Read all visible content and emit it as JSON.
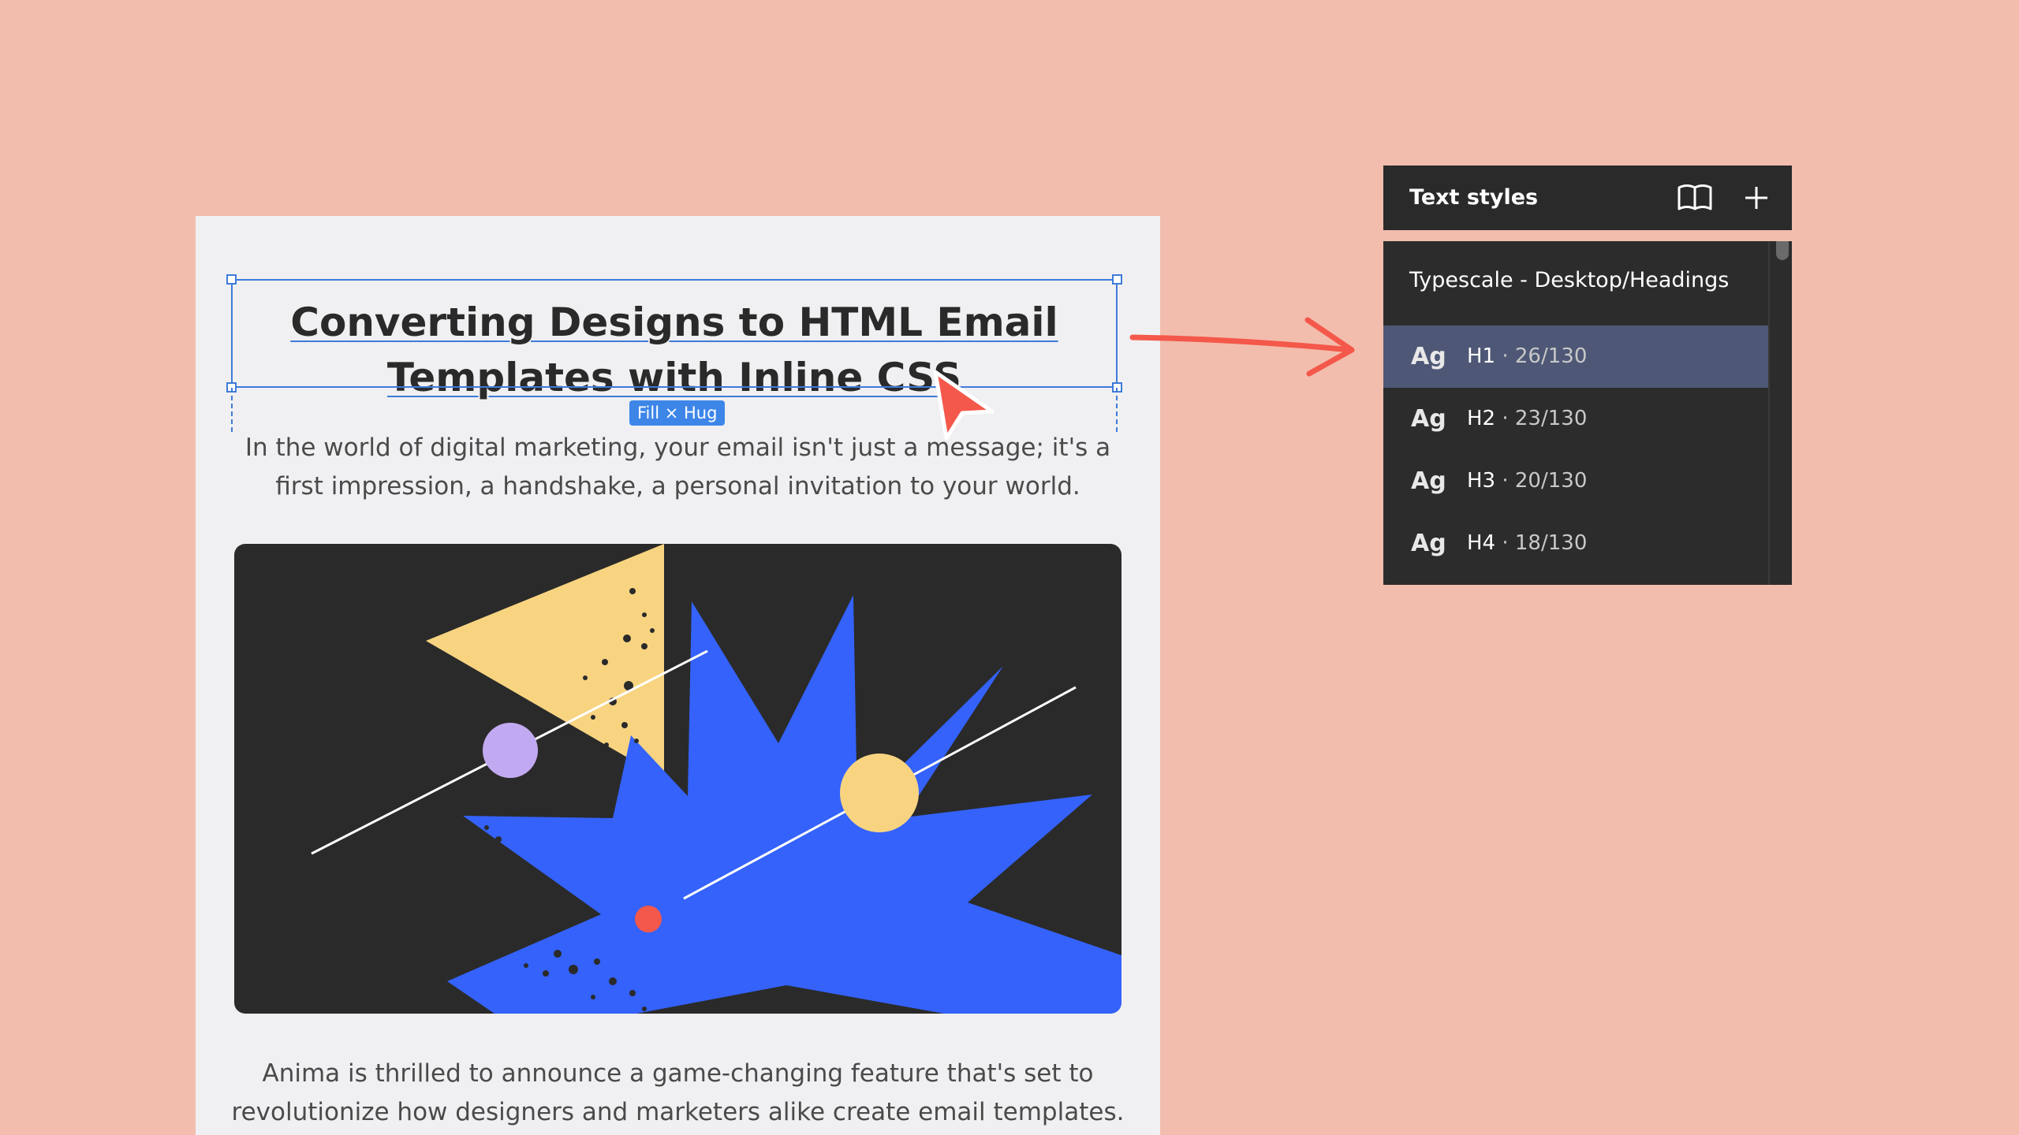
{
  "email": {
    "title_line1": "Converting Designs to HTML Email",
    "title_line2": "Templates with Inline CSS",
    "size_badge": "Fill × Hug",
    "intro_line1": "In the world of digital marketing, your email isn't just a message; it's a",
    "intro_line2": "first impression, a handshake, a personal invitation to your world.",
    "body_line1": "Anima is thrilled to announce a game-changing feature that's set to",
    "body_line2": "revolutionize how designers and marketers alike create email templates."
  },
  "panel": {
    "title": "Text styles",
    "book_icon": "book-icon",
    "add_icon": "plus-icon",
    "group_label": "Typescale - Desktop/Headings",
    "styles": [
      {
        "ag": "Ag",
        "name": "H1",
        "spec": "· 26/130",
        "selected": true
      },
      {
        "ag": "Ag",
        "name": "H2",
        "spec": "· 23/130",
        "selected": false
      },
      {
        "ag": "Ag",
        "name": "H3",
        "spec": "· 20/130",
        "selected": false
      },
      {
        "ag": "Ag",
        "name": "H4",
        "spec": "· 18/130",
        "selected": false
      }
    ]
  },
  "colors": {
    "background": "#f2bdad",
    "selection": "#3d7bd9",
    "panel": "#2c2c2c",
    "selected_row": "#4e5876",
    "cursor": "#f4584a",
    "hero_blue": "#3462fa",
    "hero_yellow": "#f8d481"
  }
}
